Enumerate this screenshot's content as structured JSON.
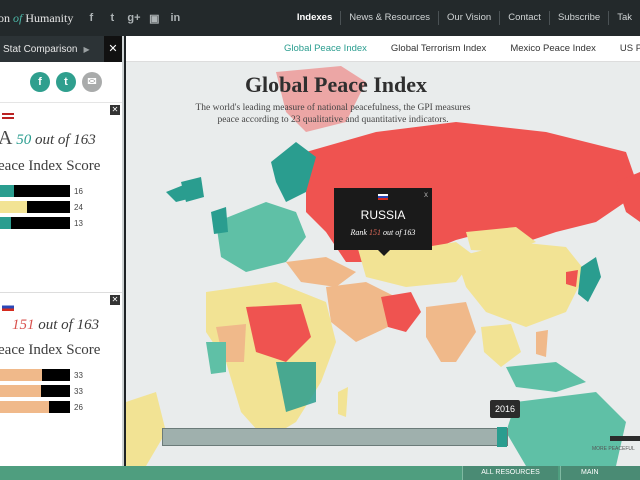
{
  "header": {
    "brand_prefix": "on",
    "brand_of": "of",
    "brand_suffix": "Humanity",
    "social": [
      "f",
      "t",
      "g+",
      "▣",
      "in"
    ],
    "nav": [
      "Indexes",
      "News & Resources",
      "Our Vision",
      "Contact",
      "Subscribe",
      "Tak"
    ]
  },
  "panel": {
    "title": "l Stat Comparison",
    "close": "✕",
    "share": [
      "f",
      "t",
      "✉"
    ],
    "cards": [
      {
        "flag": "us",
        "country_abbrev": "A",
        "rank": "50",
        "out_of": "out of 163",
        "score_title": "eace Index Score",
        "bars": [
          {
            "value": "16",
            "fill_pct": 20,
            "color": "#2a9d8f"
          },
          {
            "value": "24",
            "fill_pct": 38,
            "color": "#f2e394"
          },
          {
            "value": "13",
            "fill_pct": 15,
            "color": "#2a9d8f"
          }
        ]
      },
      {
        "flag": "ru",
        "rank": "151",
        "out_of": "out of 163",
        "score_title": "eace Index Score",
        "bars": [
          {
            "value": "33",
            "fill_pct": 60,
            "color": "#f0b98a"
          },
          {
            "value": "33",
            "fill_pct": 58,
            "color": "#f0b98a"
          },
          {
            "value": "26",
            "fill_pct": 70,
            "color": "#f0b98a"
          }
        ]
      }
    ]
  },
  "tabs": [
    "Global Peace Index",
    "Global Terrorism Index",
    "Mexico Peace Index",
    "US Peace I"
  ],
  "map": {
    "title": "Global Peace Index",
    "subtitle": "The world's leading measure of national peacefulness, the GPI measures peace according to 23 qualitative and quantitative indicators.",
    "tooltip": {
      "country": "RUSSIA",
      "rank_label": "Rank",
      "rank": "151",
      "out_of": "out of 163",
      "close": "x"
    },
    "year": "2016",
    "legend_label": "MORE PEACEFUL",
    "colors": {
      "very_high": "#2a9d8f",
      "high": "#5fc0a6",
      "medium": "#f2e394",
      "low": "#f0b98a",
      "very_low": "#ef5350",
      "no_data": "#cfd6d5"
    }
  },
  "footer": {
    "btn1": "ALL RESOURCES",
    "btn2": "MAIN"
  }
}
